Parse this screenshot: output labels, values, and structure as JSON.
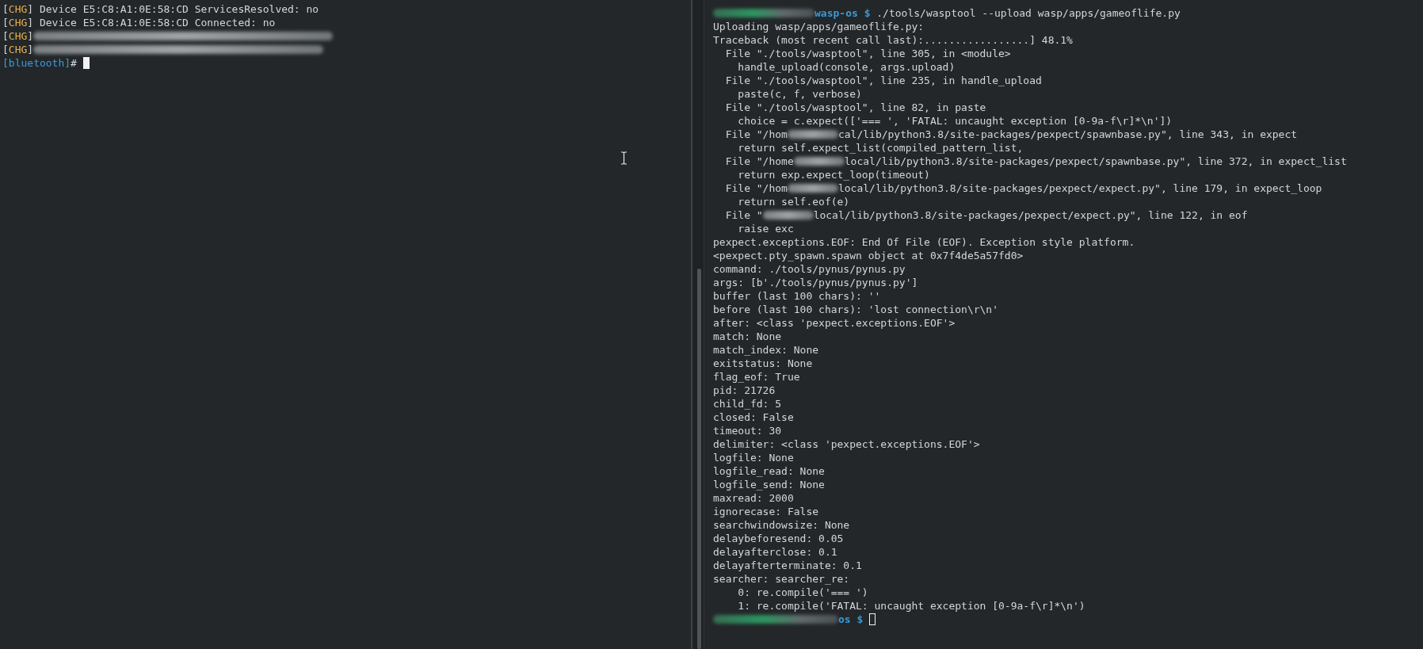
{
  "left_pane": {
    "lines": [
      {
        "open": "[",
        "tag": "CHG",
        "close": "]",
        "text": "Device E5:C8:A1:0E:58:CD ServicesResolved: no",
        "redacted": false
      },
      {
        "open": "[",
        "tag": "CHG",
        "close": "]",
        "text": "Device E5:C8:A1:0E:58:CD Connected: no",
        "redacted": false
      },
      {
        "open": "[",
        "tag": "CHG",
        "close": "]",
        "redacted": true
      },
      {
        "open": "[",
        "tag": "CHG",
        "close": "]",
        "redacted": true
      }
    ],
    "prompt": {
      "open": "[",
      "name": "bluetooth",
      "close": "]",
      "symbol": "#",
      "cursor_filled": true
    }
  },
  "right_pane": {
    "lines": [
      {
        "kind": "prompt",
        "path": "wasp-os",
        "symbol": "$",
        "command": "./tools/wasptool --upload wasp/apps/gameoflife.py"
      },
      {
        "kind": "text",
        "segments": [
          "Uploading wasp/apps/gameoflife.py:"
        ]
      },
      {
        "kind": "text",
        "segments": [
          "Traceback (most recent call last):.................] 48.1%"
        ]
      },
      {
        "kind": "text",
        "segments": [
          "  File \"./tools/wasptool\", line 305, in <module>"
        ]
      },
      {
        "kind": "text",
        "segments": [
          "    handle_upload(console, args.upload)"
        ]
      },
      {
        "kind": "text",
        "segments": [
          "  File \"./tools/wasptool\", line 235, in handle_upload"
        ]
      },
      {
        "kind": "text",
        "segments": [
          "    paste(c, f, verbose)"
        ]
      },
      {
        "kind": "text",
        "segments": [
          "  File \"./tools/wasptool\", line 82, in paste"
        ]
      },
      {
        "kind": "text",
        "segments": [
          "    choice = c.expect(['=== ', 'FATAL: uncaught exception [0-9a-f\\r]*\\n'])"
        ]
      },
      {
        "kind": "text",
        "segments": [
          "  File \"/hom",
          "cal/lib/python3.8/site-packages/pexpect/spawnbase.py\", line 343, in expect"
        ]
      },
      {
        "kind": "text",
        "segments": [
          "    return self.expect_list(compiled_pattern_list,"
        ]
      },
      {
        "kind": "text",
        "segments": [
          "  File \"/home",
          "local/lib/python3.8/site-packages/pexpect/spawnbase.py\", line 372, in expect_list"
        ]
      },
      {
        "kind": "text",
        "segments": [
          "    return exp.expect_loop(timeout)"
        ]
      },
      {
        "kind": "text",
        "segments": [
          "  File \"/hom",
          "local/lib/python3.8/site-packages/pexpect/expect.py\", line 179, in expect_loop"
        ]
      },
      {
        "kind": "text",
        "segments": [
          "    return self.eof(e)"
        ]
      },
      {
        "kind": "text",
        "segments": [
          "  File \"",
          "local/lib/python3.8/site-packages/pexpect/expect.py\", line 122, in eof"
        ]
      },
      {
        "kind": "text",
        "segments": [
          "    raise exc"
        ]
      },
      {
        "kind": "text",
        "segments": [
          "pexpect.exceptions.EOF: End Of File (EOF). Exception style platform."
        ]
      },
      {
        "kind": "text",
        "segments": [
          "<pexpect.pty_spawn.spawn object at 0x7f4de5a57fd0>"
        ]
      },
      {
        "kind": "text",
        "segments": [
          "command: ./tools/pynus/pynus.py"
        ]
      },
      {
        "kind": "text",
        "segments": [
          "args: [b'./tools/pynus/pynus.py']"
        ]
      },
      {
        "kind": "text",
        "segments": [
          "buffer (last 100 chars): ''"
        ]
      },
      {
        "kind": "text",
        "segments": [
          "before (last 100 chars): 'lost connection\\r\\n'"
        ]
      },
      {
        "kind": "text",
        "segments": [
          "after: <class 'pexpect.exceptions.EOF'>"
        ]
      },
      {
        "kind": "text",
        "segments": [
          "match: None"
        ]
      },
      {
        "kind": "text",
        "segments": [
          "match_index: None"
        ]
      },
      {
        "kind": "text",
        "segments": [
          "exitstatus: None"
        ]
      },
      {
        "kind": "text",
        "segments": [
          "flag_eof: True"
        ]
      },
      {
        "kind": "text",
        "segments": [
          "pid: 21726"
        ]
      },
      {
        "kind": "text",
        "segments": [
          "child_fd: 5"
        ]
      },
      {
        "kind": "text",
        "segments": [
          "closed: False"
        ]
      },
      {
        "kind": "text",
        "segments": [
          "timeout: 30"
        ]
      },
      {
        "kind": "text",
        "segments": [
          "delimiter: <class 'pexpect.exceptions.EOF'>"
        ]
      },
      {
        "kind": "text",
        "segments": [
          "logfile: None"
        ]
      },
      {
        "kind": "text",
        "segments": [
          "logfile_read: None"
        ]
      },
      {
        "kind": "text",
        "segments": [
          "logfile_send: None"
        ]
      },
      {
        "kind": "text",
        "segments": [
          "maxread: 2000"
        ]
      },
      {
        "kind": "text",
        "segments": [
          "ignorecase: False"
        ]
      },
      {
        "kind": "text",
        "segments": [
          "searchwindowsize: None"
        ]
      },
      {
        "kind": "text",
        "segments": [
          "delaybeforesend: 0.05"
        ]
      },
      {
        "kind": "text",
        "segments": [
          "delayafterclose: 0.1"
        ]
      },
      {
        "kind": "text",
        "segments": [
          "delayafterterminate: 0.1"
        ]
      },
      {
        "kind": "text",
        "segments": [
          "searcher: searcher_re:"
        ]
      },
      {
        "kind": "text",
        "segments": [
          "    0: re.compile('=== ')"
        ]
      },
      {
        "kind": "text",
        "segments": [
          "    1: re.compile('FATAL: uncaught exception [0-9a-f\\r]*\\n')"
        ]
      },
      {
        "kind": "prompt",
        "path": "os",
        "symbol": "$",
        "cursor_filled": false
      }
    ]
  }
}
